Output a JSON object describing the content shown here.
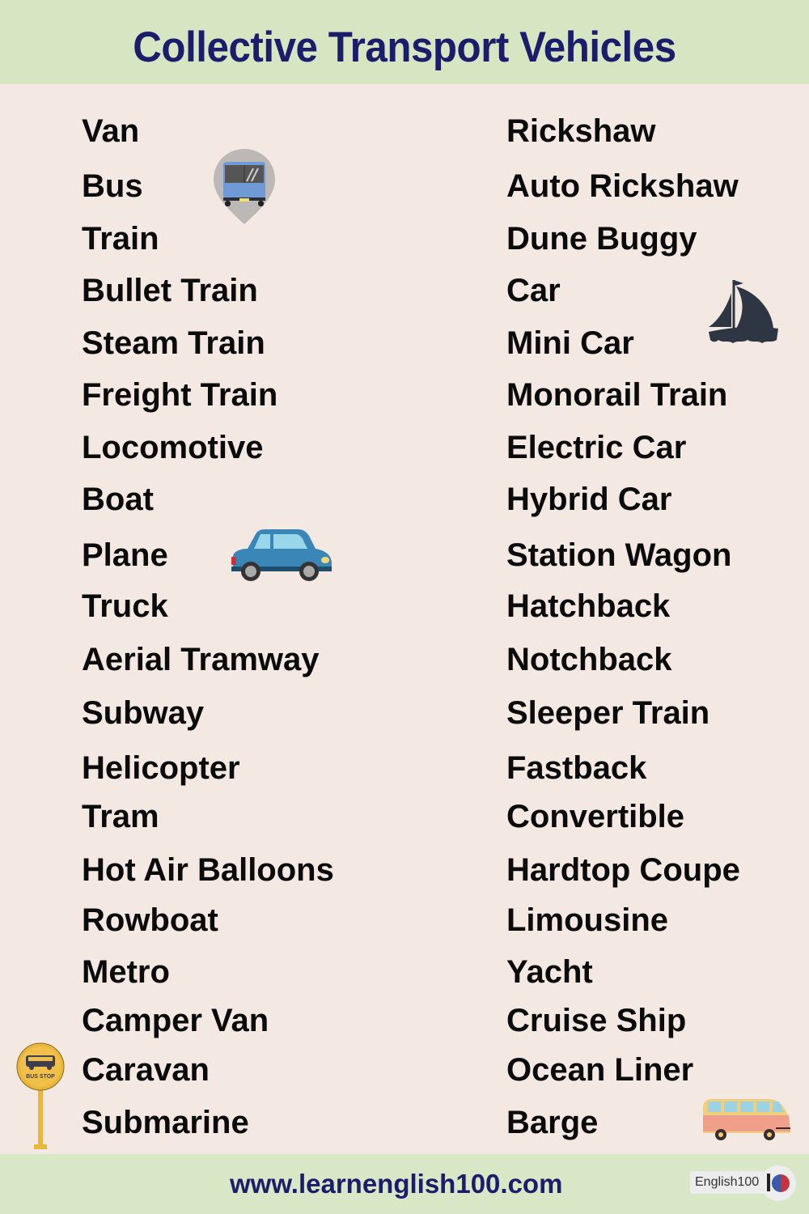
{
  "title": "Collective Transport Vehicles",
  "left_column": [
    "Van",
    "Bus",
    "Train",
    "Bullet Train",
    "Steam Train",
    "Freight Train",
    "Locomotive",
    "Boat",
    "Plane",
    "Truck",
    "Aerial Tramway",
    "Subway",
    "Helicopter",
    "Tram",
    "Hot Air Balloons",
    "Rowboat",
    "Metro",
    "Camper Van",
    "Caravan",
    "Submarine"
  ],
  "right_column": [
    "Rickshaw",
    "Auto Rickshaw",
    "Dune Buggy",
    "Car",
    "Mini Car",
    "Monorail Train",
    "Electric Car",
    "Hybrid Car",
    "Station Wagon",
    "Hatchback",
    "Notchback",
    "Sleeper Train",
    "Fastback",
    "Convertible",
    "Hardtop Coupe",
    "Limousine",
    "Yacht",
    "Cruise Ship",
    "Ocean Liner",
    "Barge"
  ],
  "illustrations": {
    "bus_pin": "bus-location-pin-icon",
    "sailboat": "sailboat-icon",
    "car": "car-icon",
    "bus_stop": "bus-stop-sign-icon",
    "bus_stop_text": "BUS STOP",
    "camper_van": "camper-van-icon"
  },
  "footer": {
    "url": "www.learnenglish100.com",
    "badge": "English100"
  },
  "colors": {
    "title": "#1b1d6b",
    "header_bg": "#d6e6c2",
    "body_bg": "#f3e9e2",
    "text": "#0b0b0b"
  }
}
